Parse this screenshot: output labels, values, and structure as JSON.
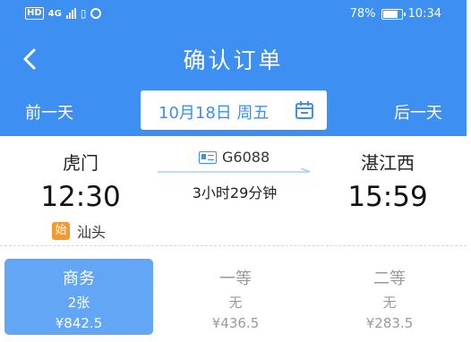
{
  "status_bar": {
    "network_type": "4G",
    "battery_percent": "78%",
    "time": "10:34",
    "icons": [
      "hd-icon",
      "signal-icon",
      "vibrate-icon",
      "sync-icon",
      "battery-icon"
    ]
  },
  "header": {
    "title": "确认订单",
    "back_icon": "chevron-left-icon",
    "accent_color": "#3d8ff2"
  },
  "date_bar": {
    "prev_label": "前一天",
    "next_label": "后一天",
    "selected_date": "10月18日 周五",
    "calendar_icon": "calendar-icon"
  },
  "train": {
    "from_station": "虎门",
    "to_station": "湛江西",
    "departure_time": "12:30",
    "arrival_time": "15:59",
    "train_number": "G6088",
    "duration": "3小时29分钟",
    "start_badge": "始",
    "origin_station": "汕头"
  },
  "seats": [
    {
      "name": "商务",
      "availability": "2张",
      "price": "¥842.5",
      "selected": true
    },
    {
      "name": "一等",
      "availability": "无",
      "price": "¥436.5",
      "selected": false
    },
    {
      "name": "二等",
      "availability": "无",
      "price": "¥283.5",
      "selected": false
    }
  ]
}
